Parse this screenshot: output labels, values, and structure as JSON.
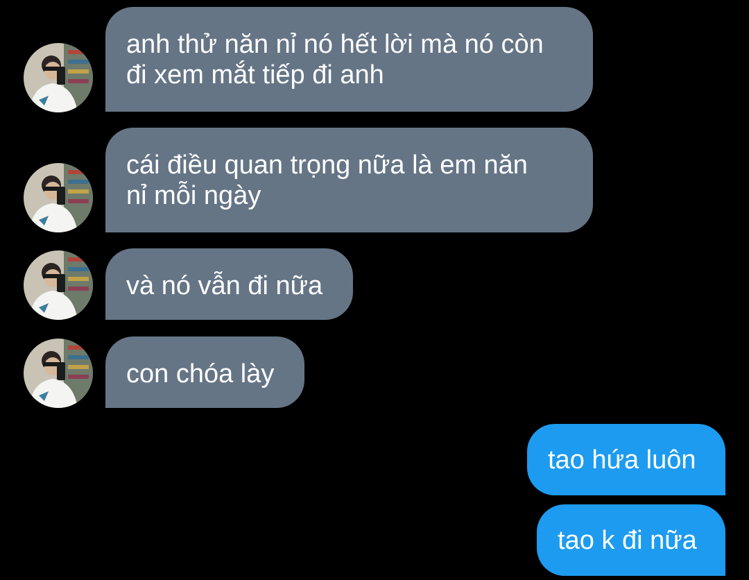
{
  "colors": {
    "background": "#000000",
    "incoming_bubble": "#657586",
    "outgoing_bubble": "#1d9bf0",
    "text": "#ffffff"
  },
  "conversation": {
    "messages": [
      {
        "direction": "incoming",
        "text": "anh thử năn nỉ nó hết lời mà nó còn\nđi xem mắt tiếp đi anh",
        "avatar": "sender-avatar"
      },
      {
        "direction": "incoming",
        "text": "cái điều quan trọng nữa là em năn\nnỉ mỗi ngày",
        "avatar": "sender-avatar"
      },
      {
        "direction": "incoming",
        "text": "và nó vẫn đi nữa",
        "avatar": "sender-avatar"
      },
      {
        "direction": "incoming",
        "text": "con chóa lày",
        "avatar": "sender-avatar"
      },
      {
        "direction": "outgoing",
        "text": "tao hứa luôn"
      },
      {
        "direction": "outgoing",
        "text": "tao k đi nữa"
      }
    ]
  }
}
